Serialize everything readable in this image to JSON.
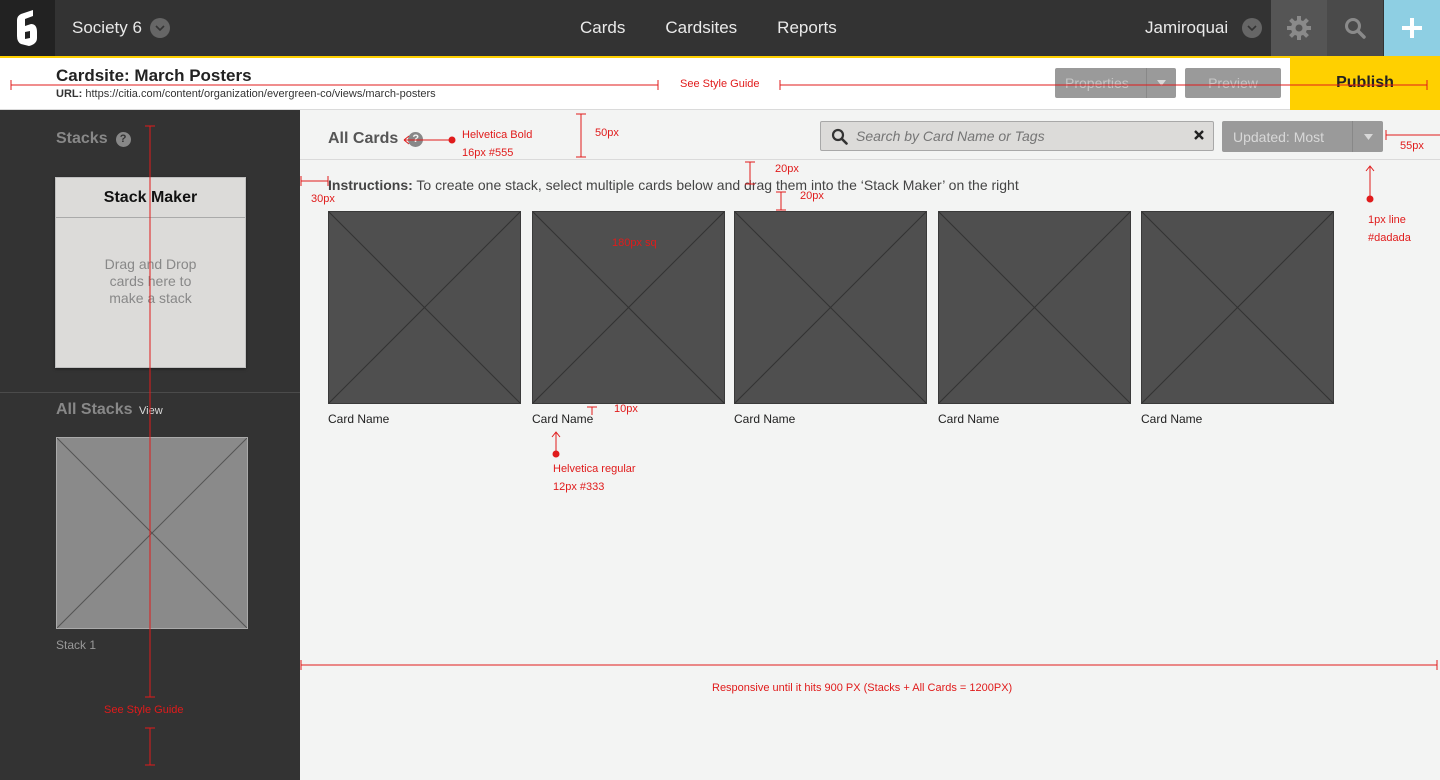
{
  "nav": {
    "org": "Society 6",
    "links": [
      "Cards",
      "Cardsites",
      "Reports"
    ],
    "user": "Jamiroquai"
  },
  "header": {
    "title": "Cardsite: March Posters",
    "url_label": "URL:",
    "url": "https://citia.com/content/organization/evergreen-co/views/march-posters",
    "properties_label": "Properties",
    "preview_label": "Preview",
    "publish_label": "Publish"
  },
  "sidebar": {
    "stacks_title": "Stacks",
    "help": "?",
    "stack_maker_title": "Stack Maker",
    "stack_maker_hint": "Drag and Drop cards here to make a stack",
    "all_stacks_title": "All Stacks",
    "view_label": "View",
    "stacks": [
      {
        "name": "Stack 1"
      }
    ]
  },
  "main": {
    "title": "All Cards",
    "help": "?",
    "search_placeholder": "Search by Card Name or Tags",
    "sort_label": "Updated: Most",
    "instructions_label": "Instructions:",
    "instructions_text": " To create one stack, select multiple cards below and drag them into the ‘Stack Maker’ on the right",
    "cards": [
      {
        "name": "Card Name"
      },
      {
        "name": "Card Name"
      },
      {
        "name": "Card Name"
      },
      {
        "name": "Card Name"
      },
      {
        "name": "Card Name"
      }
    ]
  },
  "annotations": {
    "style_guide_top": "See Style Guide",
    "helvetica_bold_1": "Helvetica Bold",
    "helvetica_bold_2": "16px #555",
    "px50": "50px",
    "px20a": "20px",
    "px20b": "20px",
    "px30": "30px",
    "px55": "55px",
    "line1": "1px line",
    "line2": "#dadada",
    "sq": "180px sq",
    "px10": "10px",
    "helvetica_reg_1": "Helvetica regular",
    "helvetica_reg_2": "12px #333",
    "responsive": "Responsive until it hits 900 PX (Stacks + All Cards = 1200PX)",
    "style_guide_side": "See Style Guide"
  },
  "colors": {
    "nav_bg": "#333333",
    "accent_yellow": "#ffd000",
    "plus_blue": "#8ecfe3",
    "annotation_red": "#e01b1b",
    "card_grey": "#4f4f4f",
    "line": "#dadada"
  },
  "icons": [
    "logo-icon",
    "chevron-down-icon",
    "gear-icon",
    "search-icon",
    "plus-icon",
    "help-icon",
    "close-icon",
    "caret-down-icon"
  ]
}
